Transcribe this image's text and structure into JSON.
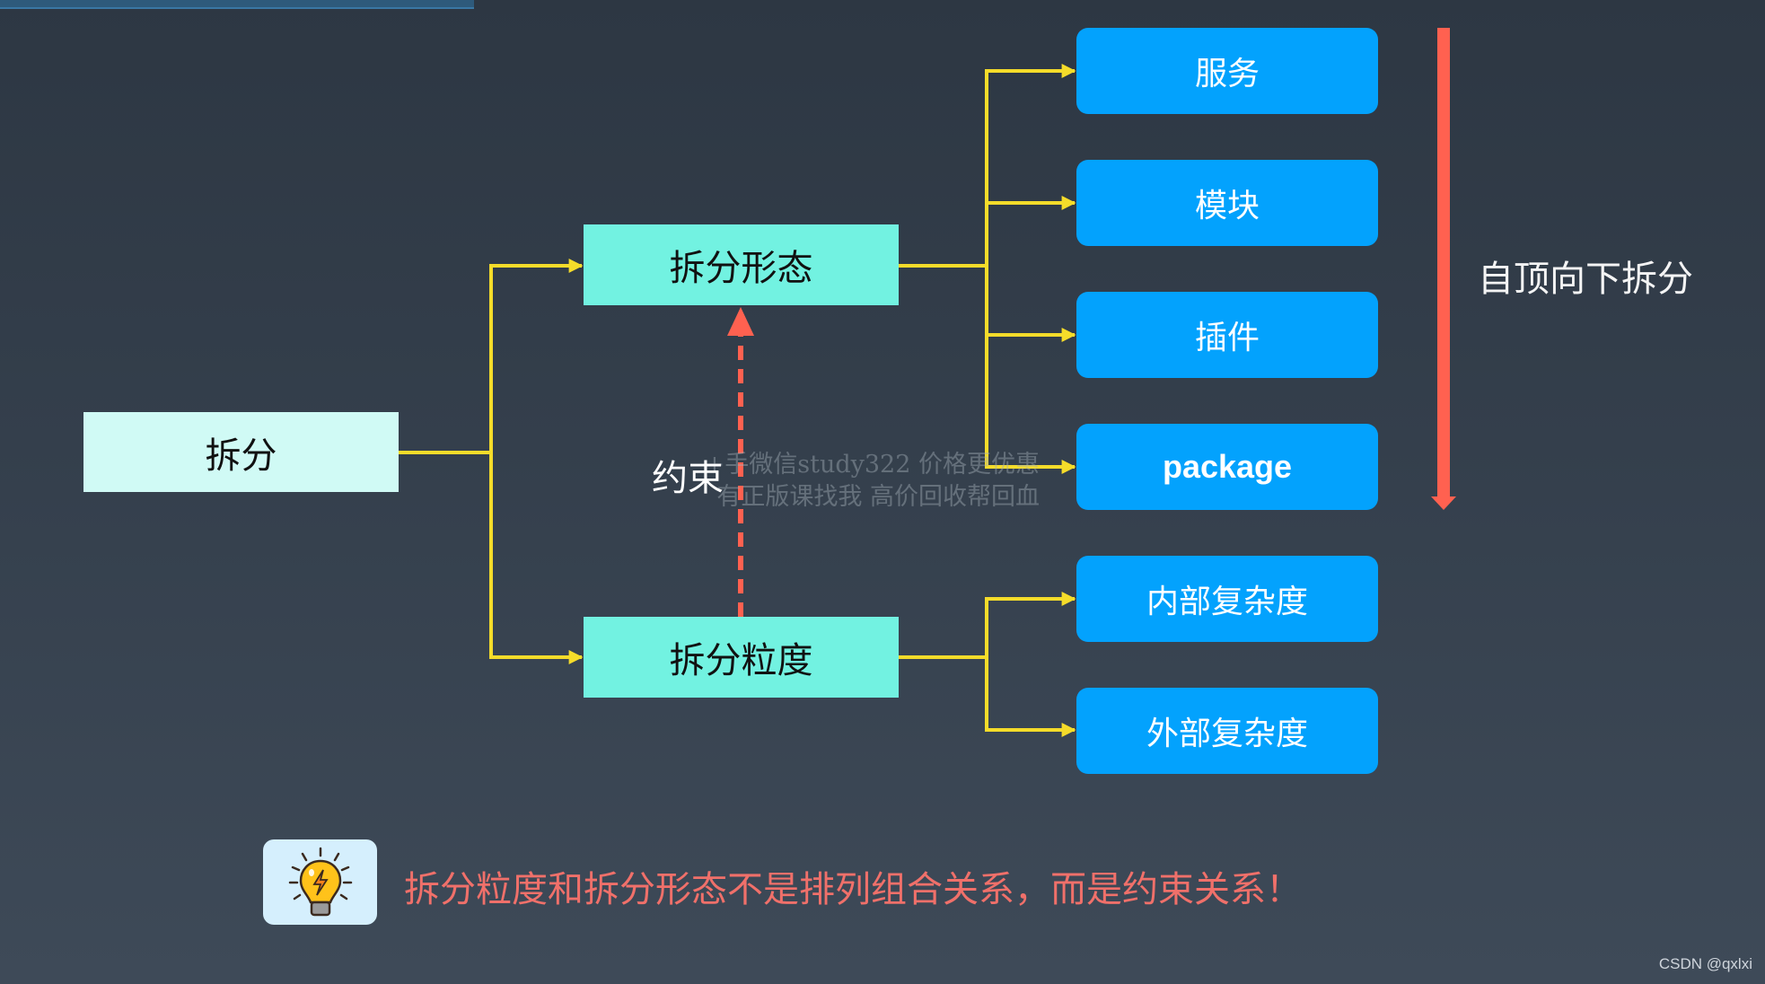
{
  "diagram": {
    "root": {
      "label": "拆分"
    },
    "branches": [
      {
        "label": "拆分形态",
        "children": [
          "服务",
          "模块",
          "插件",
          "package"
        ]
      },
      {
        "label": "拆分粒度",
        "children": [
          "内部复杂度",
          "外部复杂度"
        ]
      }
    ],
    "constraint_label": "约束",
    "direction_label": "自顶向下拆分",
    "note": "拆分粒度和拆分形态不是排列组合关系，而是约束关系！",
    "watermark_lines": [
      "+手微信study322 价格更优惠",
      "有正版课找我 高价回收帮回血"
    ],
    "credit": "CSDN @qxlxi"
  },
  "colors": {
    "connector": "#f5dc2a",
    "constraint_arrow": "#ff6150",
    "direction_arrow": "#ff6150",
    "leaf_fill": "#03a2fd",
    "branch_fill": "#72f2e1",
    "root_fill": "#d0faf5",
    "note_text": "#f0706a"
  },
  "icons": {
    "note_icon": "lightbulb-icon"
  }
}
